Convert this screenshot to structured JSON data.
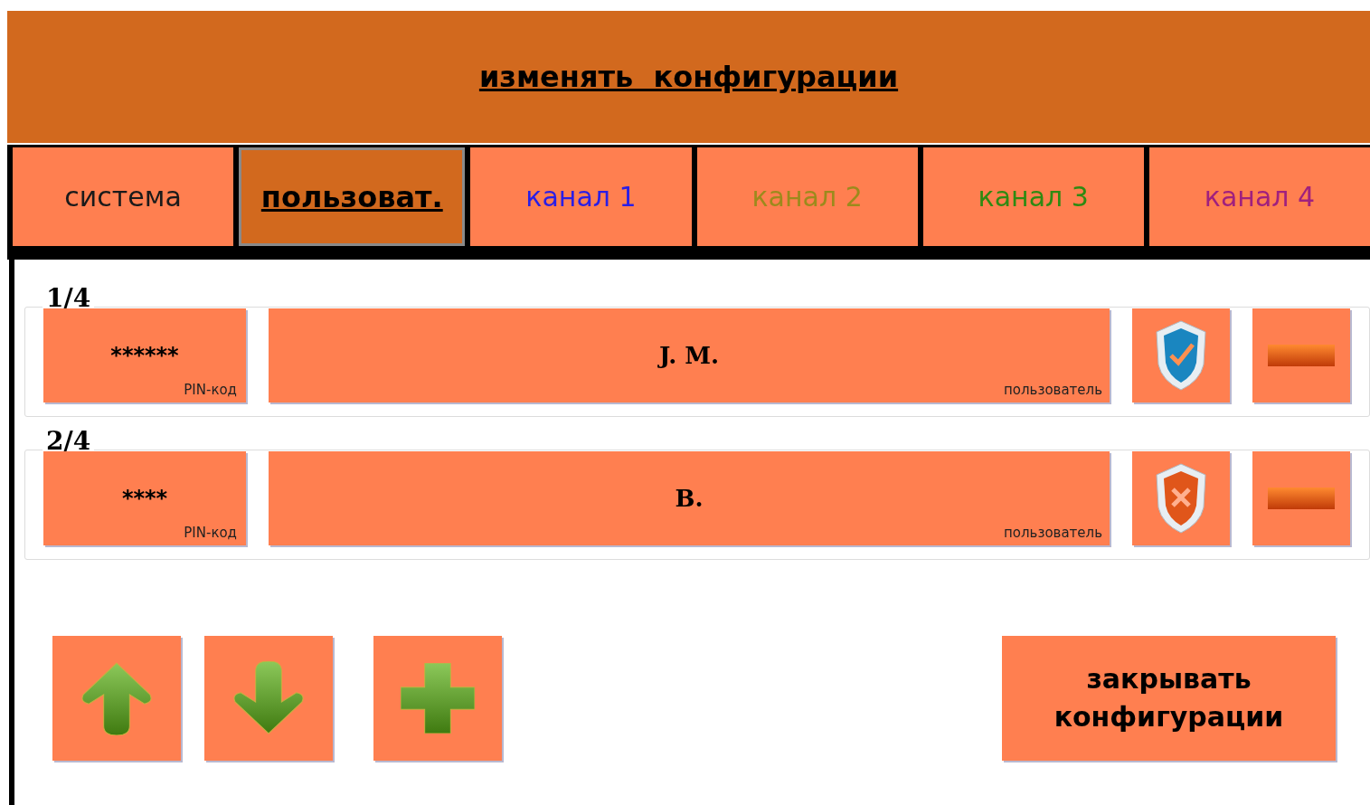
{
  "header": {
    "title": "изменять  конфигурации"
  },
  "tabs": [
    {
      "label": "система",
      "color": "#1a1a1a",
      "selected": false
    },
    {
      "label": "пользоват.",
      "color": "#000000",
      "selected": true
    },
    {
      "label": "канал 1",
      "color": "#2a1ee6",
      "selected": false
    },
    {
      "label": "канал 2",
      "color": "#9c8a1c",
      "selected": false
    },
    {
      "label": "канал 3",
      "color": "#2e8a12",
      "selected": false
    },
    {
      "label": "канал 4",
      "color": "#a0207e",
      "selected": false
    }
  ],
  "users": [
    {
      "index": "1/4",
      "pin": "******",
      "pin_label": "PIN-код",
      "name": "J. M.",
      "name_label": "пользователь",
      "verified": true
    },
    {
      "index": "2/4",
      "pin": "****",
      "pin_label": "PIN-код",
      "name": "B.",
      "name_label": "пользователь",
      "verified": false
    }
  ],
  "close_button": {
    "label": "закрывать конфигурации"
  }
}
